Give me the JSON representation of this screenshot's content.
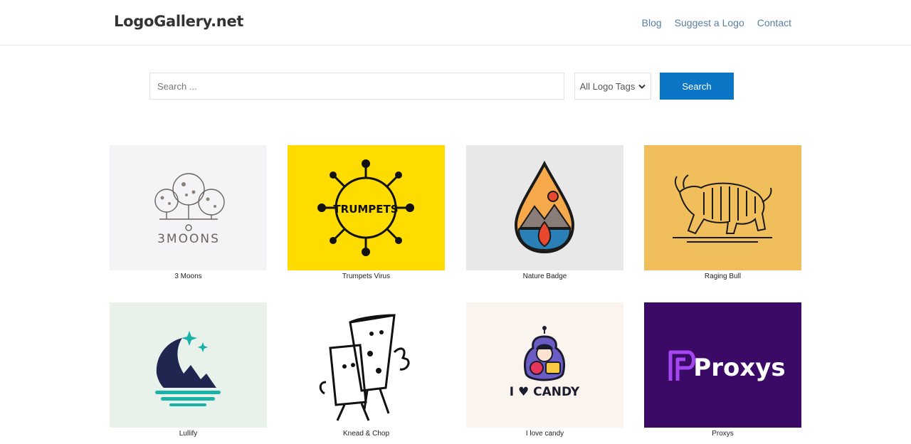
{
  "header": {
    "brand": "LogoGallery.net",
    "nav": [
      "Blog",
      "Suggest a Logo",
      "Contact"
    ]
  },
  "search": {
    "placeholder": "Search ...",
    "tag_select": "All Logo Tags",
    "button": "Search"
  },
  "logos": [
    {
      "title": "3 Moons",
      "bg": "#f4f4f6",
      "icon": "three-moons-trees-icon",
      "wordmark": "3MOONS"
    },
    {
      "title": "Trumpets Virus",
      "bg": "#fedc00",
      "icon": "trumpets-virus-icon",
      "wordmark": "TRUMPETS"
    },
    {
      "title": "Nature Badge",
      "bg": "#e8e8e8",
      "icon": "nature-badge-drop-icon"
    },
    {
      "title": "Raging Bull",
      "bg": "#f1be5c",
      "icon": "raging-bull-icon"
    },
    {
      "title": "Lullify",
      "bg": "#e8f2ea",
      "icon": "lullify-moon-boat-icon"
    },
    {
      "title": "Knead & Chop",
      "bg": "#ffffff",
      "icon": "knead-chop-pizza-icon"
    },
    {
      "title": "I love candy",
      "bg": "#faf3ee",
      "icon": "i-love-candy-icon",
      "wordmark": "I ♥ CANDY"
    },
    {
      "title": "Proxys",
      "bg": "#3a0a66",
      "icon": "proxys-p-icon",
      "wordmark": "Proxys"
    }
  ],
  "colors": {
    "nav_link": "#5a7fa6",
    "search_button": "#0b76c5",
    "lullify_teal": "#1ab3a8",
    "lullify_navy": "#1f2650",
    "proxys_purple": "#a646f0"
  }
}
